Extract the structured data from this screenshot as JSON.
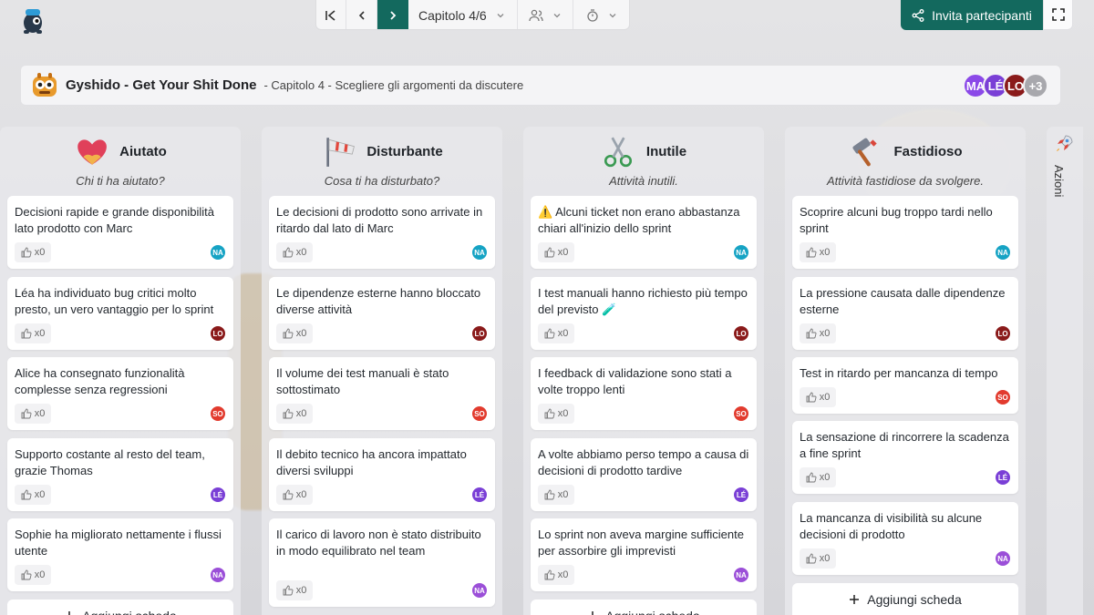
{
  "topbar": {
    "chapter_label": "Capitolo 4/6",
    "invite_label": "Invita partecipanti"
  },
  "header": {
    "title": "Gyshido - Get Your Shit Done",
    "subtitle": "- Capitolo 4 - Scegliere gli argomenti da discutere",
    "participants": [
      {
        "initials": "MA",
        "color": "#8b49e8"
      },
      {
        "initials": "LÉ",
        "color": "#7a3fd6"
      },
      {
        "initials": "LO",
        "color": "#8a1a1a"
      },
      {
        "initials": "+3",
        "color": "#a8a8ad"
      }
    ]
  },
  "columns": [
    {
      "title": "Aiutato",
      "subtitle": "Chi ti ha aiutato?",
      "icon": "heart-hands-icon",
      "add_label": "Aggiungi scheda",
      "cards": [
        {
          "text": "Decisioni rapide e grande disponibilità lato prodotto con Marc",
          "likes": "x0",
          "author": "NA",
          "color": "#16a3c4"
        },
        {
          "text": "Léa ha individuato bug critici molto presto, un vero vantaggio per lo sprint",
          "likes": "x0",
          "author": "LO",
          "color": "#8a1a1a"
        },
        {
          "text": "Alice ha consegnato funzionalità complesse senza regressioni",
          "likes": "x0",
          "author": "SO",
          "color": "#e23b2e"
        },
        {
          "text": "Supporto costante al resto del team, grazie Thomas",
          "likes": "x0",
          "author": "LÉ",
          "color": "#7a3fd6"
        },
        {
          "text": "Sophie ha migliorato nettamente i flussi utente",
          "likes": "x0",
          "author": "NA",
          "color": "#9b4fd8"
        }
      ]
    },
    {
      "title": "Disturbante",
      "subtitle": "Cosa ti ha disturbato?",
      "icon": "windsock-icon",
      "cards": [
        {
          "text": "Le decisioni di prodotto sono arrivate in ritardo dal lato di Marc",
          "likes": "x0",
          "author": "NA",
          "color": "#16a3c4"
        },
        {
          "text": "Le dipendenze esterne hanno bloccato diverse attività",
          "likes": "x0",
          "author": "LO",
          "color": "#8a1a1a"
        },
        {
          "text": "Il volume dei test manuali è stato sottostimato",
          "likes": "x0",
          "author": "SO",
          "color": "#e23b2e"
        },
        {
          "text": "Il debito tecnico ha ancora impattato diversi sviluppi",
          "likes": "x0",
          "author": "LÉ",
          "color": "#7a3fd6"
        },
        {
          "text": "Il carico di lavoro non è stato distribuito in modo equilibrato nel team",
          "likes": "x0",
          "author": "NA",
          "color": "#9b4fd8"
        }
      ]
    },
    {
      "title": "Inutile",
      "subtitle": "Attività inutili.",
      "icon": "scissors-icon",
      "add_label": "Aggiungi scheda",
      "cards": [
        {
          "text": "⚠️ Alcuni ticket non erano abbastanza chiari all'inizio dello sprint",
          "likes": "x0",
          "author": "NA",
          "color": "#16a3c4"
        },
        {
          "text": "I test manuali hanno richiesto più tempo del previsto 🧪",
          "likes": "x0",
          "author": "LO",
          "color": "#8a1a1a"
        },
        {
          "text": "I feedback di validazione sono stati a volte troppo lenti",
          "likes": "x0",
          "author": "SO",
          "color": "#e23b2e"
        },
        {
          "text": "A volte abbiamo perso tempo a causa di decisioni di prodotto tardive",
          "likes": "x0",
          "author": "LÉ",
          "color": "#7a3fd6"
        },
        {
          "text": "Lo sprint non aveva margine sufficiente per assorbire gli imprevisti",
          "likes": "x0",
          "author": "NA",
          "color": "#9b4fd8"
        }
      ]
    },
    {
      "title": "Fastidioso",
      "subtitle": "Attività fastidiose da svolgere.",
      "icon": "hammer-icon",
      "add_label": "Aggiungi scheda",
      "cards": [
        {
          "text": "Scoprire alcuni bug troppo tardi nello sprint",
          "likes": "x0",
          "author": "NA",
          "color": "#16a3c4"
        },
        {
          "text": "La pressione causata dalle dipendenze esterne",
          "likes": "x0",
          "author": "LO",
          "color": "#8a1a1a"
        },
        {
          "text": "Test in ritardo per mancanza di tempo",
          "likes": "x0",
          "author": "SO",
          "color": "#e23b2e"
        },
        {
          "text": "La sensazione di rincorrere la scadenza a fine sprint",
          "likes": "x0",
          "author": "LÉ",
          "color": "#7a3fd6"
        },
        {
          "text": "La mancanza di visibilità su alcune decisioni di prodotto",
          "likes": "x0",
          "author": "NA",
          "color": "#9b4fd8"
        }
      ]
    }
  ],
  "actions_label": "Azioni",
  "colors": {
    "accent": "#13695e"
  }
}
